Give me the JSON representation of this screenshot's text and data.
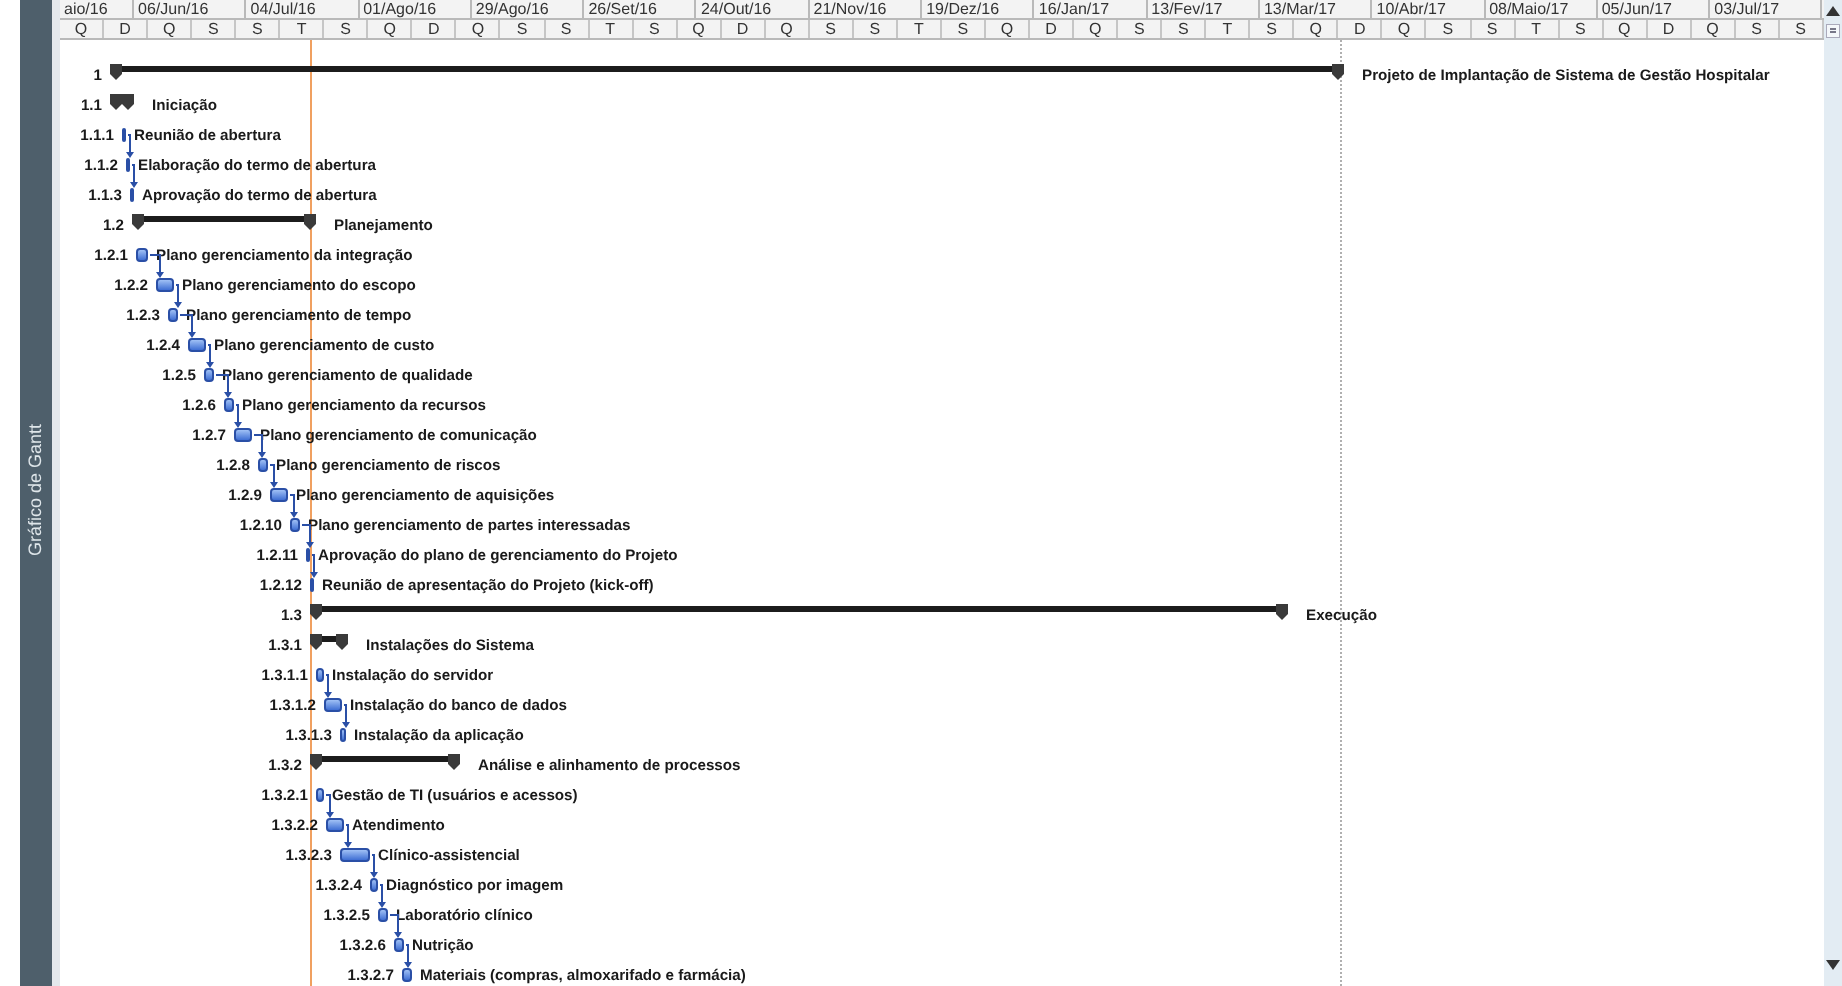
{
  "sidebar": {
    "label": "Gráfico de Gantt"
  },
  "timescale": {
    "top": [
      "aio/16",
      "06/Jun/16",
      "04/Jul/16",
      "01/Ago/16",
      "29/Ago/16",
      "26/Set/16",
      "24/Out/16",
      "21/Nov/16",
      "19/Dez/16",
      "16/Jan/17",
      "13/Fev/17",
      "13/Mar/17",
      "10/Abr/17",
      "08/Maio/17",
      "05/Jun/17",
      "03/Jul/17"
    ],
    "bottom": [
      "Q",
      "D",
      "Q",
      "S",
      "S",
      "T",
      "S",
      "Q",
      "D",
      "Q",
      "S",
      "S",
      "T",
      "S",
      "Q",
      "D",
      "Q",
      "S",
      "S",
      "T",
      "S",
      "Q",
      "D",
      "Q",
      "S",
      "S",
      "T",
      "S",
      "Q",
      "D",
      "Q",
      "S",
      "S",
      "T",
      "S",
      "Q",
      "D",
      "Q",
      "S",
      "S"
    ]
  },
  "tasks": [
    {
      "wbs": "1",
      "name": "Projeto de Implantação de Sistema de Gestão Hospitalar",
      "kind": "summary"
    },
    {
      "wbs": "1.1",
      "name": "Iniciação",
      "kind": "summary"
    },
    {
      "wbs": "1.1.1",
      "name": "Reunião de abertura",
      "kind": "task"
    },
    {
      "wbs": "1.1.2",
      "name": "Elaboração do termo de abertura",
      "kind": "task"
    },
    {
      "wbs": "1.1.3",
      "name": "Aprovação do termo de abertura",
      "kind": "task"
    },
    {
      "wbs": "1.2",
      "name": "Planejamento",
      "kind": "summary"
    },
    {
      "wbs": "1.2.1",
      "name": "Plano gerenciamento da integração",
      "kind": "task"
    },
    {
      "wbs": "1.2.2",
      "name": "Plano gerenciamento do escopo",
      "kind": "task"
    },
    {
      "wbs": "1.2.3",
      "name": "Plano gerenciamento de tempo",
      "kind": "task"
    },
    {
      "wbs": "1.2.4",
      "name": "Plano gerenciamento de custo",
      "kind": "task"
    },
    {
      "wbs": "1.2.5",
      "name": "Plano gerenciamento de qualidade",
      "kind": "task"
    },
    {
      "wbs": "1.2.6",
      "name": "Plano gerenciamento da recursos",
      "kind": "task"
    },
    {
      "wbs": "1.2.7",
      "name": "Plano gerenciamento de comunicação",
      "kind": "task"
    },
    {
      "wbs": "1.2.8",
      "name": "Plano gerenciamento de riscos",
      "kind": "task"
    },
    {
      "wbs": "1.2.9",
      "name": "Plano gerenciamento de aquisições",
      "kind": "task"
    },
    {
      "wbs": "1.2.10",
      "name": "Plano gerenciamento de partes interessadas",
      "kind": "task"
    },
    {
      "wbs": "1.2.11",
      "name": "Aprovação do plano de gerenciamento do Projeto",
      "kind": "task"
    },
    {
      "wbs": "1.2.12",
      "name": "Reunião de apresentação do Projeto (kick-off)",
      "kind": "task"
    },
    {
      "wbs": "1.3",
      "name": "Execução",
      "kind": "summary"
    },
    {
      "wbs": "1.3.1",
      "name": "Instalações do Sistema",
      "kind": "summary"
    },
    {
      "wbs": "1.3.1.1",
      "name": "Instalação do servidor",
      "kind": "task"
    },
    {
      "wbs": "1.3.1.2",
      "name": "Instalação do banco de dados",
      "kind": "task"
    },
    {
      "wbs": "1.3.1.3",
      "name": "Instalação da aplicação",
      "kind": "task"
    },
    {
      "wbs": "1.3.2",
      "name": "Análise e alinhamento de processos",
      "kind": "summary"
    },
    {
      "wbs": "1.3.2.1",
      "name": "Gestão de TI (usuários e acessos)",
      "kind": "task"
    },
    {
      "wbs": "1.3.2.2",
      "name": "Atendimento",
      "kind": "task"
    },
    {
      "wbs": "1.3.2.3",
      "name": "Clínico-assistencial",
      "kind": "task"
    },
    {
      "wbs": "1.3.2.4",
      "name": "Diagnóstico por imagem",
      "kind": "task"
    },
    {
      "wbs": "1.3.2.5",
      "name": "Laboratório clínico",
      "kind": "task"
    },
    {
      "wbs": "1.3.2.6",
      "name": "Nutrição",
      "kind": "task"
    },
    {
      "wbs": "1.3.2.7",
      "name": "Materiais (compras, almoxarifado e farmácia)",
      "kind": "task"
    }
  ]
}
